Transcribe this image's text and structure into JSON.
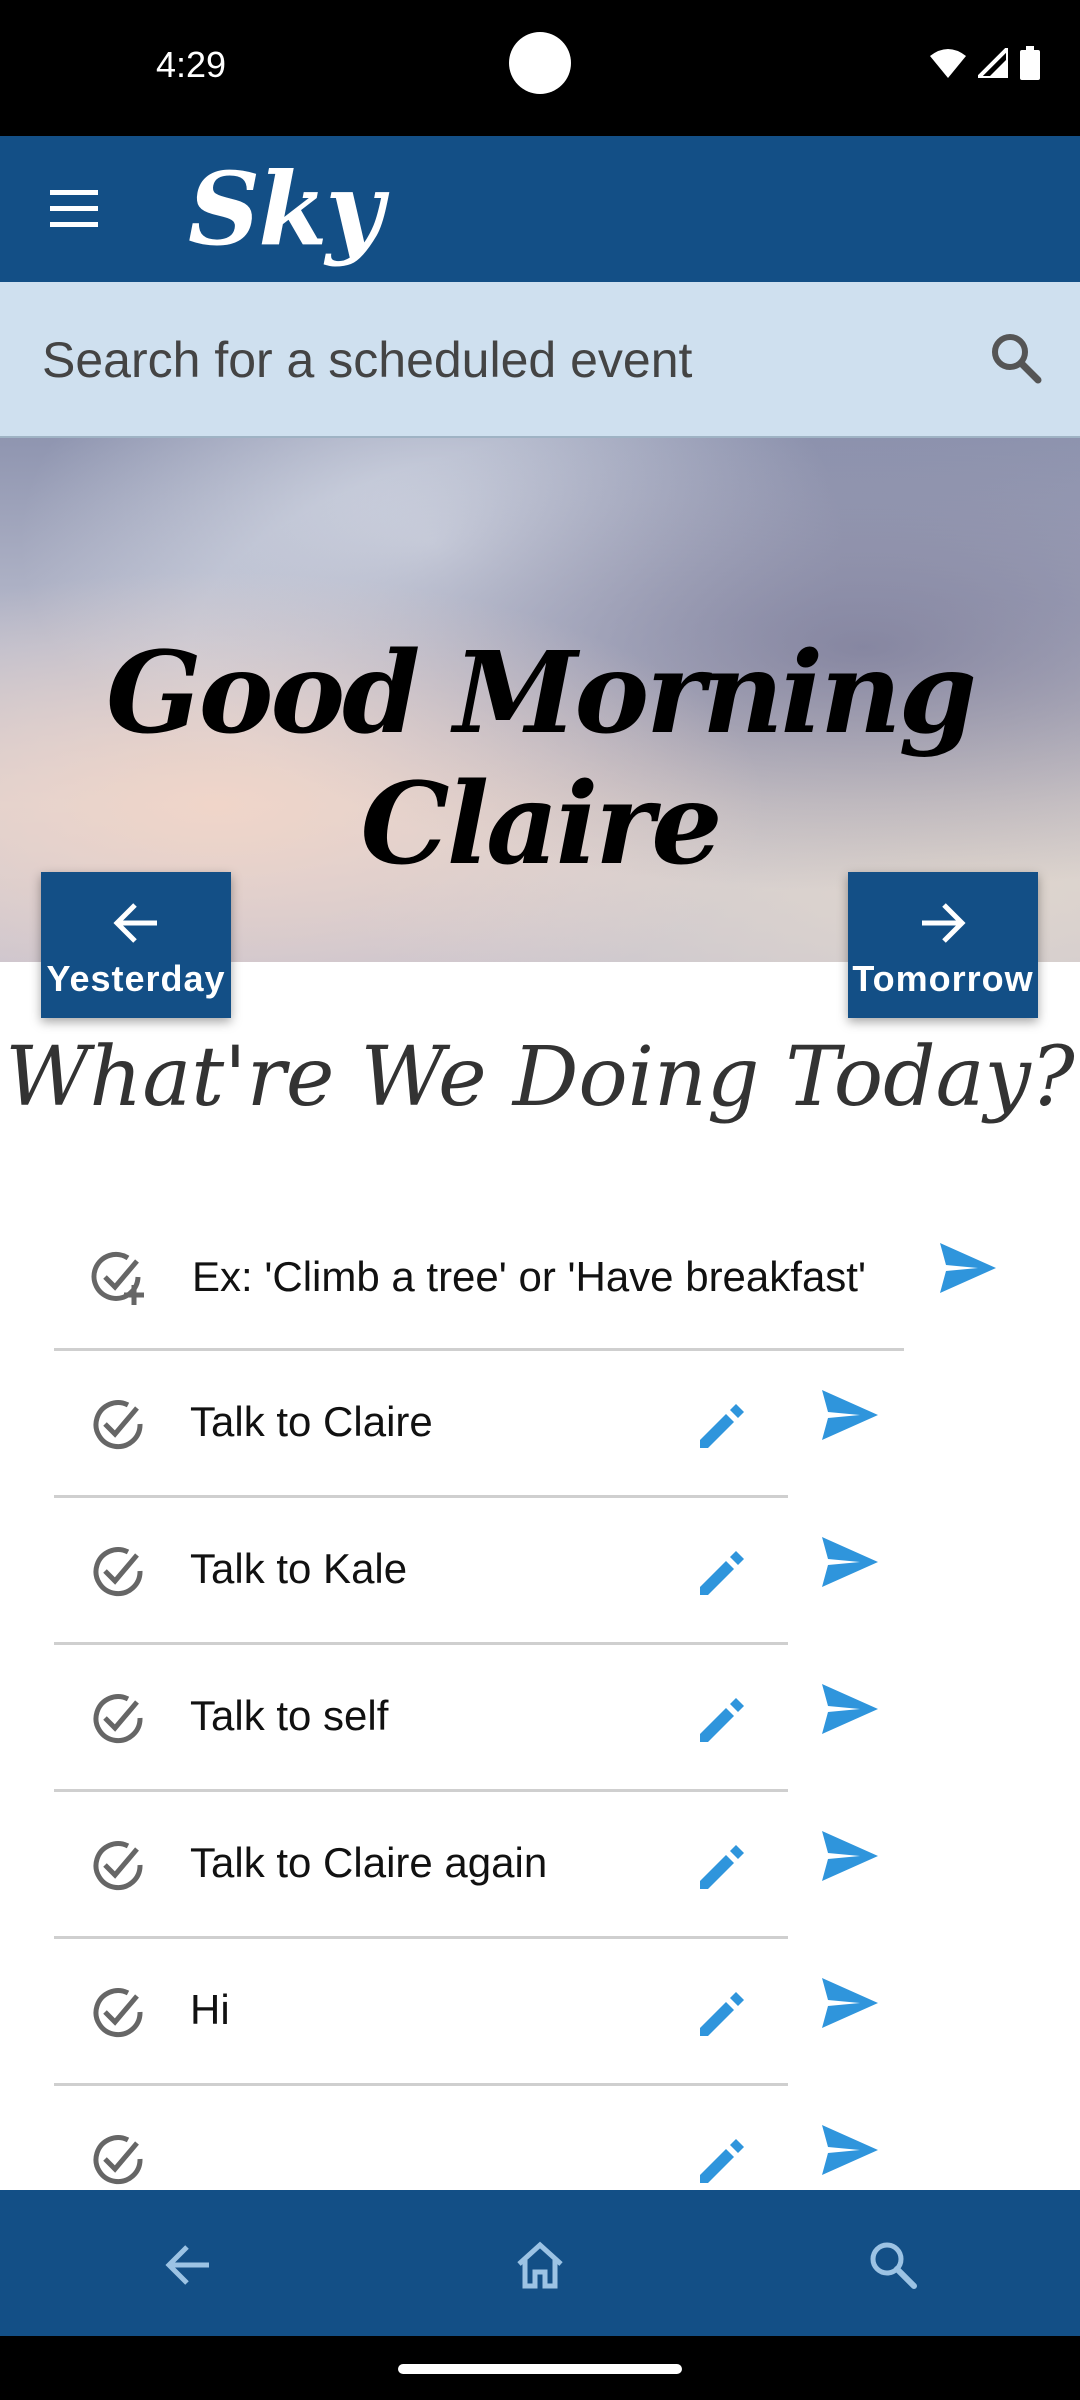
{
  "status_bar": {
    "time": "4:29"
  },
  "app_bar": {
    "title": "Sky"
  },
  "search": {
    "placeholder": "Search for a scheduled event"
  },
  "hero": {
    "greeting": "Good Morning Claire"
  },
  "nav": {
    "yesterday_label": "Yesterday",
    "tomorrow_label": "Tomorrow"
  },
  "subtitle": "What're We Doing Today?",
  "new_item": {
    "placeholder": "Ex: 'Climb a tree' or 'Have breakfast'"
  },
  "items": [
    {
      "label": "Talk to Claire"
    },
    {
      "label": "Talk to Kale"
    },
    {
      "label": "Talk to self"
    },
    {
      "label": "Talk to Claire again"
    },
    {
      "label": "Hi"
    },
    {
      "label": ""
    }
  ],
  "colors": {
    "primary": "#134f86",
    "accent": "#2f95dc",
    "search_bg": "#cfe0ef"
  },
  "icons": [
    "menu-icon",
    "search-icon",
    "arrow-left-icon",
    "arrow-right-icon",
    "add-check-icon",
    "check-circle-icon",
    "edit-pencil-icon",
    "send-icon",
    "back-icon",
    "home-icon"
  ]
}
